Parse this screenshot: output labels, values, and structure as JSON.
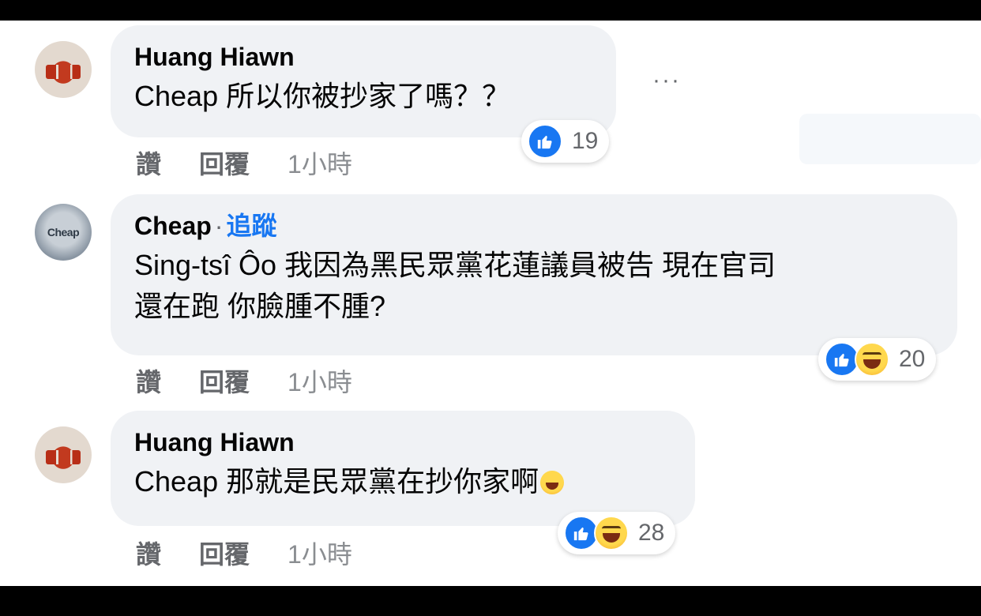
{
  "comments": [
    {
      "author": "Huang Hiawn",
      "text": "Cheap 所以你被抄家了嗎？？",
      "actions": {
        "like": "讚",
        "reply": "回覆",
        "time": "1小時"
      },
      "reaction_count": "19"
    },
    {
      "author": "Cheap",
      "separator": "·",
      "follow_label": "追蹤",
      "text": "Sing-tsî Ôo 我因為黑民眾黨花蓮議員被告 現在官司\n還在跑 你臉腫不腫?",
      "actions": {
        "like": "讚",
        "reply": "回覆",
        "time": "1小時"
      },
      "reaction_count": "20"
    },
    {
      "author": "Huang Hiawn",
      "text": "Cheap 那就是民眾黨在抄你家啊",
      "actions": {
        "like": "讚",
        "reply": "回覆",
        "time": "1小時"
      },
      "reaction_count": "28"
    }
  ],
  "more_menu": "···",
  "avatar_cheap_text": "Cheap",
  "icons": {
    "like": "like-reaction-icon",
    "haha": "haha-reaction-icon",
    "more": "more-options-icon"
  },
  "colors": {
    "accent": "#1877f2",
    "bubble": "#f0f2f5",
    "muted": "#65676b"
  }
}
